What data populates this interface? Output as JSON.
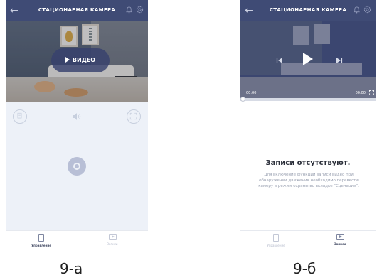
{
  "colors": {
    "header": "#3f4b75",
    "panel": "#edf1f8",
    "player": "#3b4670",
    "accent_button": "#b8bfd6"
  },
  "screen_a": {
    "header": {
      "title": "СТАЦИОНАРНАЯ КАМЕРА",
      "back_icon": "arrow-left-icon",
      "bell_icon": "bell-icon",
      "settings_icon": "gear-icon"
    },
    "video_button_label": "ВИДЕО",
    "controls": {
      "left_icon": "keypad-icon",
      "mid_icon": "speaker-icon",
      "right_icon": "fullscreen-icon",
      "center_icon": "camera-icon"
    },
    "tabs": [
      {
        "label": "Управление",
        "icon": "remote-icon",
        "active": true
      },
      {
        "label": "Записи",
        "icon": "record-icon",
        "active": false
      }
    ]
  },
  "screen_b": {
    "header": {
      "title": "СТАЦИОНАРНАЯ КАМЕРА",
      "back_icon": "arrow-left-icon",
      "bell_icon": "bell-icon",
      "settings_icon": "gear-icon"
    },
    "player": {
      "time_start": "00:00",
      "time_end": "00:00",
      "progress": 0
    },
    "empty_title": "Записи отсутствуют.",
    "empty_description": "Для включение функции записи видео при обнаружении движения необходимо перевести камеру в режим охраны во вкладке \"Сценарии\".",
    "tabs": [
      {
        "label": "Управление",
        "icon": "remote-icon",
        "active": false
      },
      {
        "label": "Записи",
        "icon": "record-icon",
        "active": true
      }
    ]
  },
  "captions": {
    "a": "9-а",
    "b": "9-б"
  }
}
